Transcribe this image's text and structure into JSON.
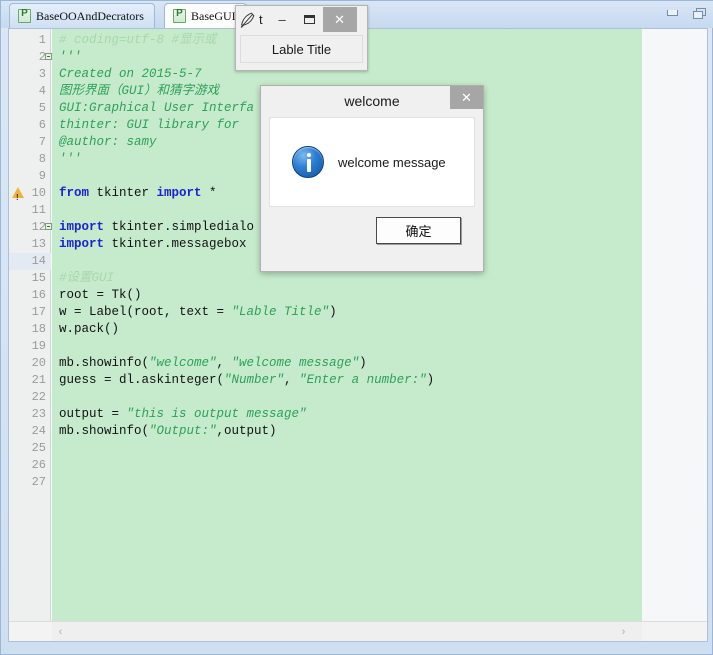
{
  "ide": {
    "tabs": [
      {
        "label": "BaseOOAndDecrators",
        "icon": "python-file-icon",
        "active": false
      },
      {
        "label": "BaseGUI",
        "icon": "python-file-icon",
        "active": true
      }
    ],
    "window_controls": {
      "minimize": "minimize-icon",
      "restore": "restore-icon"
    },
    "scrollbar": {
      "left_arrow": "‹",
      "right_arrow": "›"
    }
  },
  "code": {
    "lines": [
      {
        "n": "1",
        "text": "# coding=utf-8 #显示或",
        "style": "comment",
        "fold": false,
        "warn": false,
        "hl": false
      },
      {
        "n": "2",
        "text": "'''",
        "style": "doc",
        "fold": true,
        "warn": false,
        "hl": false
      },
      {
        "n": "3",
        "text": "Created on 2015-5-7",
        "style": "doc",
        "fold": false,
        "warn": false,
        "hl": false
      },
      {
        "n": "4",
        "text": "图形界面（GUI）和猜字游戏",
        "style": "doc",
        "fold": false,
        "warn": false,
        "hl": false
      },
      {
        "n": "5",
        "text": "GUI:Graphical User Interfa",
        "style": "doc",
        "fold": false,
        "warn": false,
        "hl": false
      },
      {
        "n": "6",
        "text": "thinter: GUI library for",
        "style": "doc",
        "fold": false,
        "warn": false,
        "hl": false
      },
      {
        "n": "7",
        "text": "@author: samy",
        "style": "doc",
        "fold": false,
        "warn": false,
        "hl": false
      },
      {
        "n": "8",
        "text": "'''",
        "style": "doc",
        "fold": false,
        "warn": false,
        "hl": false
      },
      {
        "n": "9",
        "text": "",
        "style": "plain",
        "fold": false,
        "warn": false,
        "hl": false
      },
      {
        "n": "10",
        "text": "from tkinter import *",
        "style": "import-star",
        "fold": false,
        "warn": true,
        "hl": false
      },
      {
        "n": "11",
        "text": "",
        "style": "plain",
        "fold": false,
        "warn": false,
        "hl": false
      },
      {
        "n": "12",
        "text": "import tkinter.simpledialo",
        "style": "import",
        "fold": true,
        "warn": false,
        "hl": false
      },
      {
        "n": "13",
        "text": "import tkinter.messagebox",
        "style": "import",
        "fold": false,
        "warn": false,
        "hl": false
      },
      {
        "n": "14",
        "text": "",
        "style": "plain",
        "fold": false,
        "warn": false,
        "hl": true
      },
      {
        "n": "15",
        "text": "#设置GUI",
        "style": "comment",
        "fold": false,
        "warn": false,
        "hl": false
      },
      {
        "n": "16",
        "text": "root = Tk()",
        "style": "plain",
        "fold": false,
        "warn": false,
        "hl": false
      },
      {
        "n": "17",
        "text": "w = Label(root, text = \"Lable Title\")",
        "style": "label-line",
        "fold": false,
        "warn": false,
        "hl": false
      },
      {
        "n": "18",
        "text": "w.pack()",
        "style": "plain",
        "fold": false,
        "warn": false,
        "hl": false
      },
      {
        "n": "19",
        "text": "",
        "style": "plain",
        "fold": false,
        "warn": false,
        "hl": false
      },
      {
        "n": "20",
        "text": "mb.showinfo(\"welcome\", \"welcome message\")",
        "style": "showinfo-welcome",
        "fold": false,
        "warn": false,
        "hl": false
      },
      {
        "n": "21",
        "text": "guess = dl.askinteger(\"Number\", \"Enter a number:\")",
        "style": "askinteger",
        "fold": false,
        "warn": false,
        "hl": false
      },
      {
        "n": "22",
        "text": "",
        "style": "plain",
        "fold": false,
        "warn": false,
        "hl": false
      },
      {
        "n": "23",
        "text": "output = \"this is output message\"",
        "style": "output-assign",
        "fold": false,
        "warn": false,
        "hl": false
      },
      {
        "n": "24",
        "text": "mb.showinfo(\"Output:\",output)",
        "style": "showinfo-output",
        "fold": false,
        "warn": false,
        "hl": false
      },
      {
        "n": "25",
        "text": "",
        "style": "plain",
        "fold": false,
        "warn": false,
        "hl": false
      },
      {
        "n": "26",
        "text": "",
        "style": "plain",
        "fold": false,
        "warn": false,
        "hl": false
      },
      {
        "n": "27",
        "text": "",
        "style": "plain",
        "fold": false,
        "warn": false,
        "hl": false
      }
    ]
  },
  "tk_root_window": {
    "title": "t",
    "icon": "feather-icon",
    "minimize_label": "–",
    "maximize_label": "❐",
    "close_label": "✕",
    "label_text": "Lable Title"
  },
  "welcome_dialog": {
    "title": "welcome",
    "close_label": "✕",
    "icon": "info-icon",
    "message": "welcome message",
    "ok_label": "确定"
  },
  "colors": {
    "editor_background": "#c6ebcc",
    "gutter_background": "#eef0ef",
    "current_line": "#dde8f7",
    "keyword": "#1a22d6",
    "string": "#2da05a",
    "comment": "#a8d6ae",
    "warning": "#f0b23c",
    "info_icon": "#1e6fc4",
    "titlebar": "#f0f0f0",
    "close_button": "#a6a6a6"
  }
}
